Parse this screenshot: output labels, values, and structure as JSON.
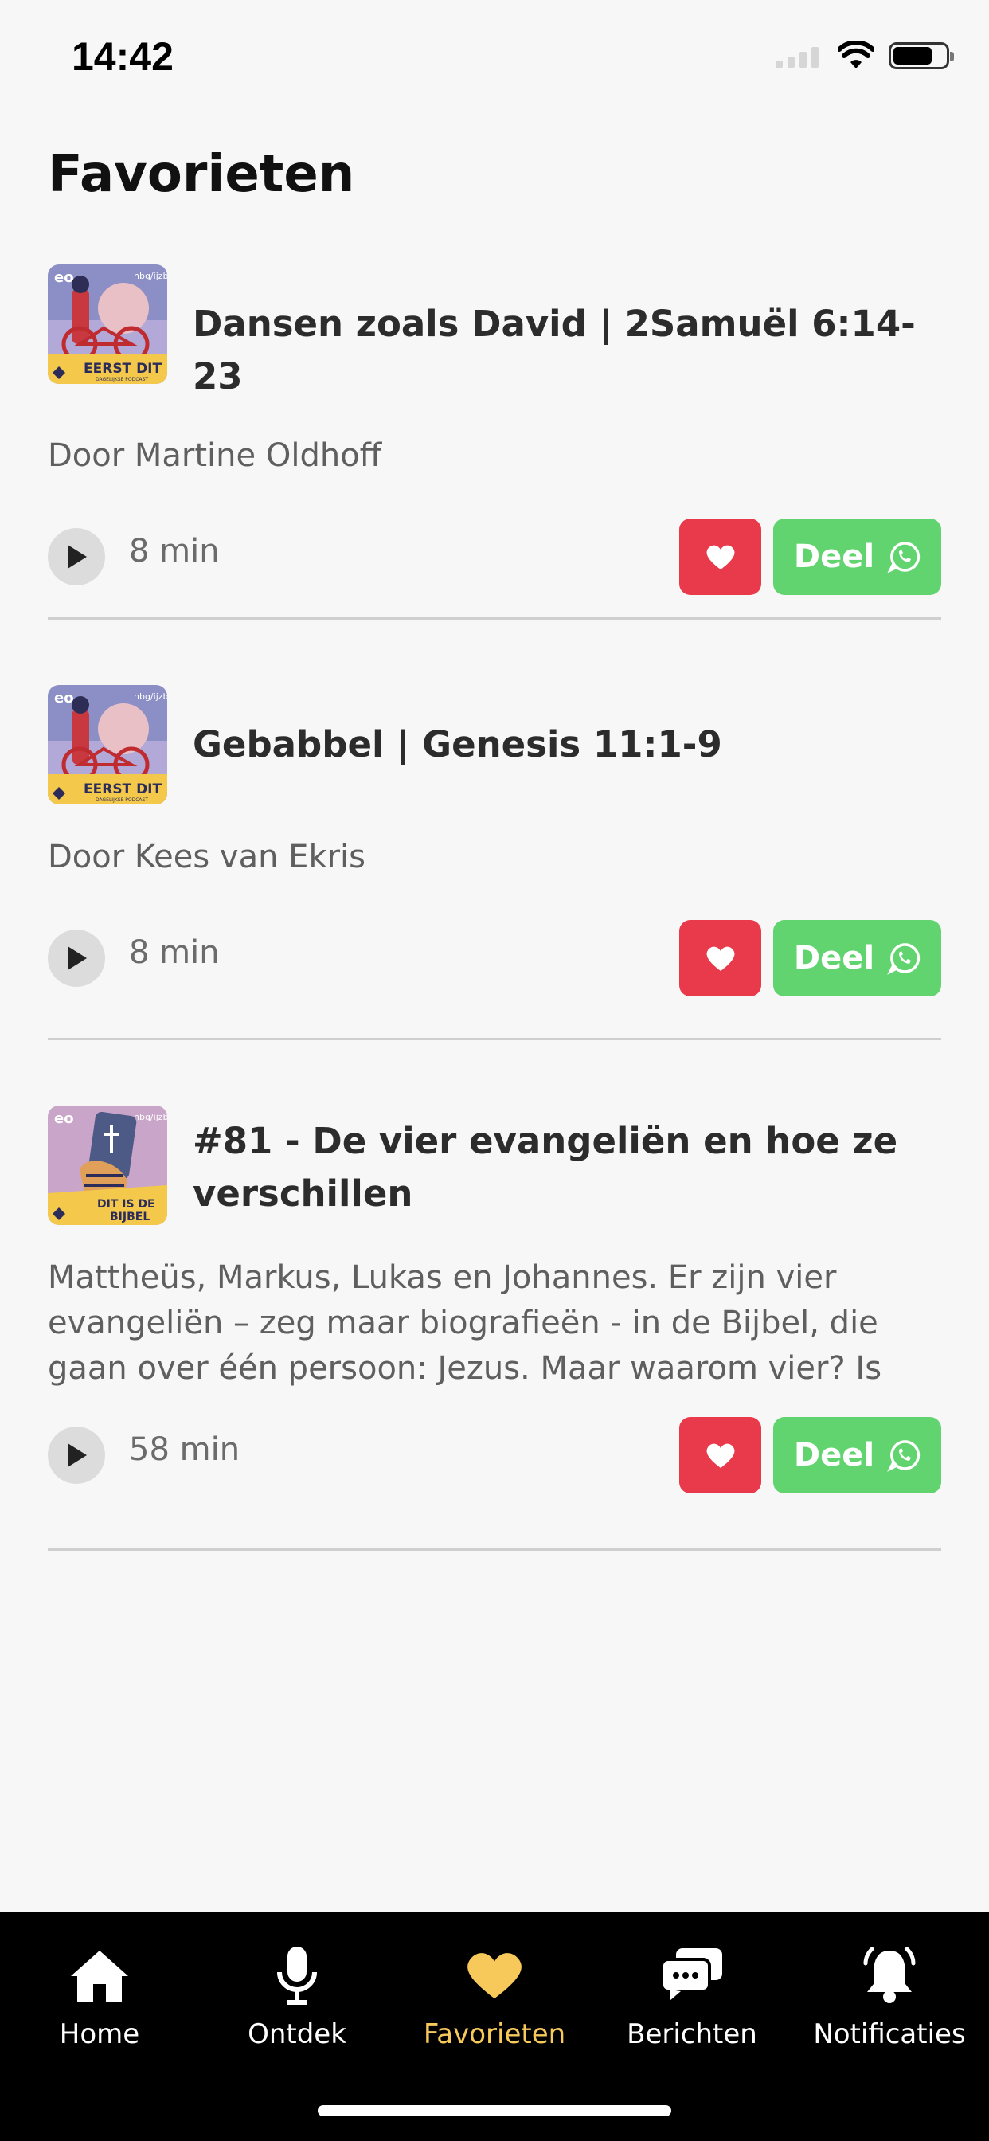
{
  "status_bar": {
    "time": "14:42"
  },
  "page": {
    "title": "Favorieten"
  },
  "episodes": [
    {
      "title": "Dansen zoals David | 2Samuël 6:14-23",
      "description": "Door Martine Oldhoff",
      "duration": "8 min",
      "share_label": "Deel",
      "thumbnail": {
        "brand": "eo",
        "partner": "nbg/ijzb",
        "caption": "EERST DIT",
        "sub": "DAGELIJKSE PODCAST"
      }
    },
    {
      "title": "Gebabbel | Genesis 11:1-9",
      "description": "Door Kees van Ekris",
      "duration": "8 min",
      "share_label": "Deel",
      "thumbnail": {
        "brand": "eo",
        "partner": "nbg/ijzb",
        "caption": "EERST DIT",
        "sub": "DAGELIJKSE PODCAST"
      }
    },
    {
      "title": "#81 - De vier evangeliën en hoe ze verschillen",
      "description": "Mattheüs, Markus, Lukas en Johannes. Er zijn vier evangeliën – zeg maar biografieën - in de Bijbel, die gaan over één persoon: Jezus. Maar waarom vier? Is dat niet v...",
      "duration": "58 min",
      "share_label": "Deel",
      "thumbnail": {
        "brand": "eo",
        "partner": "nbg/ijzb",
        "caption_line1": "DIT IS DE",
        "caption_line2": "BIJBEL"
      }
    }
  ],
  "tab_bar": {
    "tabs": [
      {
        "label": "Home",
        "icon": "home-icon"
      },
      {
        "label": "Ontdek",
        "icon": "microphone-icon"
      },
      {
        "label": "Favorieten",
        "icon": "heart-icon",
        "active": true
      },
      {
        "label": "Berichten",
        "icon": "chat-bubbles-icon"
      },
      {
        "label": "Notificaties",
        "icon": "bell-icon"
      }
    ]
  },
  "colors": {
    "favorite": "#e83a4a",
    "share": "#61d46f",
    "active_tab": "#f6c95a",
    "tab_bar_bg": "#000000"
  }
}
